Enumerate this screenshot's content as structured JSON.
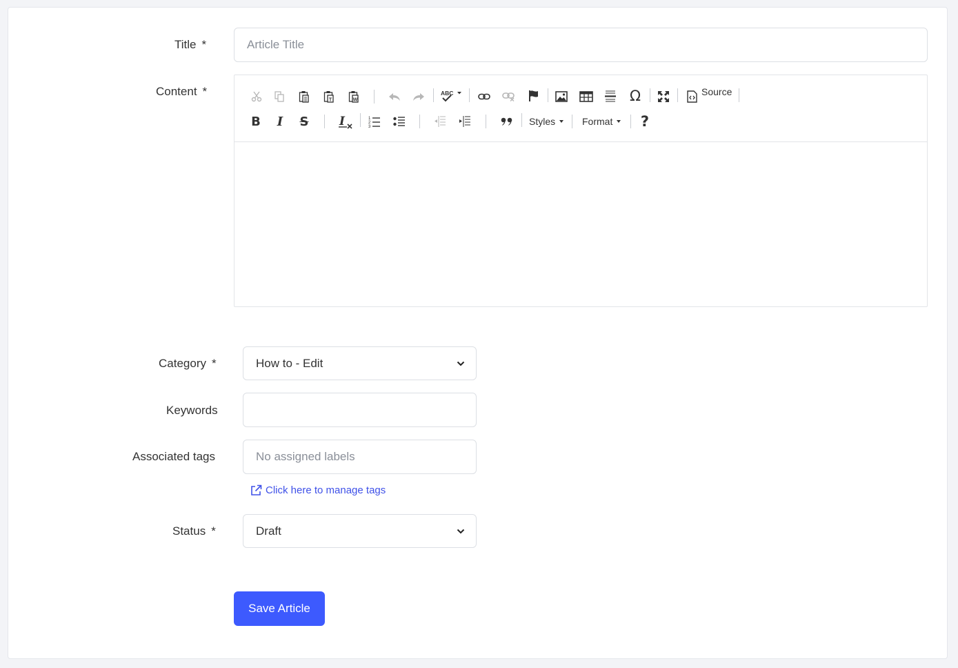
{
  "form": {
    "title_label": "Title",
    "content_label": "Content",
    "category_label": "Category",
    "keywords_label": "Keywords",
    "tags_label": "Associated tags",
    "status_label": "Status",
    "required_mark": "*",
    "title_placeholder": "Article Title",
    "category_value": "How to - Edit",
    "keywords_value": "",
    "tags_placeholder": "No assigned labels",
    "manage_tags_link": "Click here to manage tags",
    "status_value": "Draft",
    "save_label": "Save Article"
  },
  "editor": {
    "source_label": "Source",
    "styles_label": "Styles",
    "format_label": "Format",
    "content": ""
  },
  "colors": {
    "primary": "#3d5afe",
    "link": "#3f51e8"
  },
  "icons": [
    "cut-icon",
    "copy-icon",
    "paste-icon",
    "paste-text-icon",
    "paste-word-icon",
    "undo-icon",
    "redo-icon",
    "spellcheck-icon",
    "link-icon",
    "unlink-icon",
    "anchor-icon",
    "image-icon",
    "table-icon",
    "horizontal-line-icon",
    "special-char-icon",
    "maximize-icon",
    "source-icon",
    "bold-icon",
    "italic-icon",
    "strike-icon",
    "remove-format-icon",
    "numbered-list-icon",
    "bulleted-list-icon",
    "outdent-icon",
    "indent-icon",
    "blockquote-icon",
    "help-icon",
    "external-link-icon",
    "chevron-down-icon"
  ]
}
